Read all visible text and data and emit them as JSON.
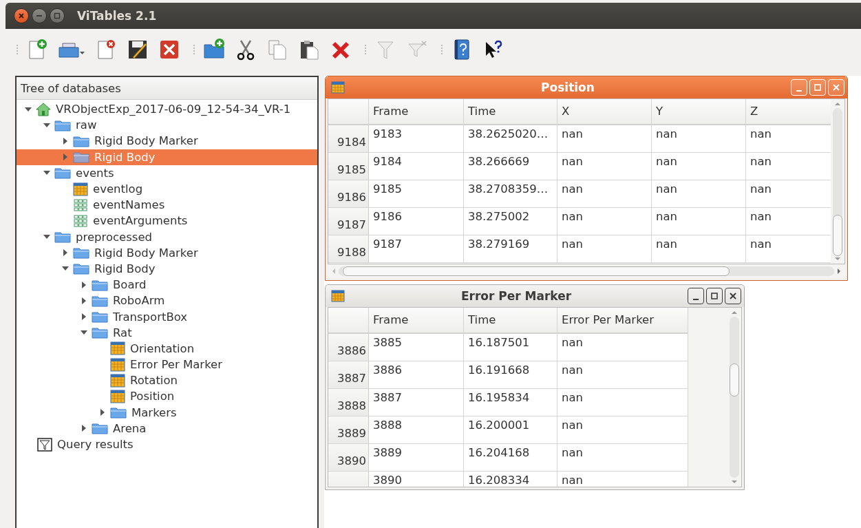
{
  "window": {
    "title": "ViTables 2.1"
  },
  "toolbar": {
    "groups": [
      [
        {
          "kind": "new-file",
          "disabled": false
        },
        {
          "kind": "open-file",
          "disabled": false
        },
        {
          "kind": "close-file",
          "disabled": false
        },
        {
          "kind": "save-as",
          "disabled": false
        },
        {
          "kind": "close-all",
          "disabled": false
        }
      ],
      [
        {
          "kind": "new-group",
          "disabled": false
        },
        {
          "kind": "cut",
          "disabled": false
        },
        {
          "kind": "copy",
          "disabled": false
        },
        {
          "kind": "paste",
          "disabled": false
        },
        {
          "kind": "delete",
          "disabled": false
        }
      ],
      [
        {
          "kind": "query",
          "disabled": true
        },
        {
          "kind": "delete-queries",
          "disabled": true
        }
      ],
      [
        {
          "kind": "help",
          "disabled": false
        },
        {
          "kind": "whats-this",
          "disabled": false
        }
      ]
    ]
  },
  "tree": {
    "title": "Tree of databases",
    "items": [
      {
        "label": "VRObjectExp_2017-06-09_12-54-34_VR-1",
        "kind": "database",
        "expanded": true,
        "selected": false,
        "children": [
          {
            "label": "raw",
            "kind": "group",
            "expanded": true,
            "selected": false,
            "children": [
              {
                "label": "Rigid Body Marker",
                "kind": "group",
                "expanded": false,
                "selected": false
              },
              {
                "label": "Rigid Body",
                "kind": "group",
                "expanded": false,
                "selected": true
              }
            ]
          },
          {
            "label": "events",
            "kind": "group",
            "expanded": true,
            "selected": false,
            "children": [
              {
                "label": "eventlog",
                "kind": "table",
                "selected": false
              },
              {
                "label": "eventNames",
                "kind": "array",
                "selected": false
              },
              {
                "label": "eventArguments",
                "kind": "array",
                "selected": false
              }
            ]
          },
          {
            "label": "preprocessed",
            "kind": "group",
            "expanded": true,
            "selected": false,
            "children": [
              {
                "label": "Rigid Body Marker",
                "kind": "group",
                "expanded": false,
                "selected": false
              },
              {
                "label": "Rigid Body",
                "kind": "group",
                "expanded": true,
                "selected": false,
                "children": [
                  {
                    "label": "Board",
                    "kind": "group",
                    "expanded": false,
                    "selected": false
                  },
                  {
                    "label": "RoboArm",
                    "kind": "group",
                    "expanded": false,
                    "selected": false
                  },
                  {
                    "label": "TransportBox",
                    "kind": "group",
                    "expanded": false,
                    "selected": false
                  },
                  {
                    "label": "Rat",
                    "kind": "group",
                    "expanded": true,
                    "selected": false,
                    "children": [
                      {
                        "label": "Orientation",
                        "kind": "table",
                        "selected": false
                      },
                      {
                        "label": "Error Per Marker",
                        "kind": "table",
                        "selected": false
                      },
                      {
                        "label": "Rotation",
                        "kind": "table",
                        "selected": false
                      },
                      {
                        "label": "Position",
                        "kind": "table",
                        "selected": false
                      },
                      {
                        "label": "Markers",
                        "kind": "group",
                        "expanded": false,
                        "selected": false
                      }
                    ]
                  },
                  {
                    "label": "Arena",
                    "kind": "group",
                    "expanded": false,
                    "selected": false
                  }
                ]
              }
            ]
          }
        ]
      },
      {
        "label": "Query results",
        "kind": "query",
        "selected": false
      }
    ]
  },
  "windows": [
    {
      "title": "Position",
      "active": true,
      "horizontal_scrollbar": true,
      "columns": [
        "Frame",
        "Time",
        "X",
        "Y",
        "Z"
      ],
      "rows": [
        {
          "header": "9184",
          "cells": [
            "9183",
            "38.2625020…",
            "nan",
            "nan",
            "nan"
          ]
        },
        {
          "header": "9185",
          "cells": [
            "9184",
            "38.266669",
            "nan",
            "nan",
            "nan"
          ]
        },
        {
          "header": "9186",
          "cells": [
            "9185",
            "38.2708359…",
            "nan",
            "nan",
            "nan"
          ]
        },
        {
          "header": "9187",
          "cells": [
            "9186",
            "38.275002",
            "nan",
            "nan",
            "nan"
          ]
        },
        {
          "header": "9188",
          "cells": [
            "9187",
            "38.279169",
            "nan",
            "nan",
            "nan"
          ]
        }
      ]
    },
    {
      "title": "Error Per Marker",
      "active": false,
      "horizontal_scrollbar": false,
      "columns": [
        "Frame",
        "Time",
        "Error Per Marker"
      ],
      "rows": [
        {
          "header": "3886",
          "cells": [
            "3885",
            "16.187501",
            "nan"
          ]
        },
        {
          "header": "3887",
          "cells": [
            "3886",
            "16.191668",
            "nan"
          ]
        },
        {
          "header": "3888",
          "cells": [
            "3887",
            "16.195834",
            "nan"
          ]
        },
        {
          "header": "3889",
          "cells": [
            "3888",
            "16.200001",
            "nan"
          ]
        },
        {
          "header": "3890",
          "cells": [
            "3889",
            "16.204168",
            "nan"
          ]
        },
        {
          "cells": [
            "3890",
            "16.208334",
            "nan"
          ]
        }
      ]
    }
  ]
}
